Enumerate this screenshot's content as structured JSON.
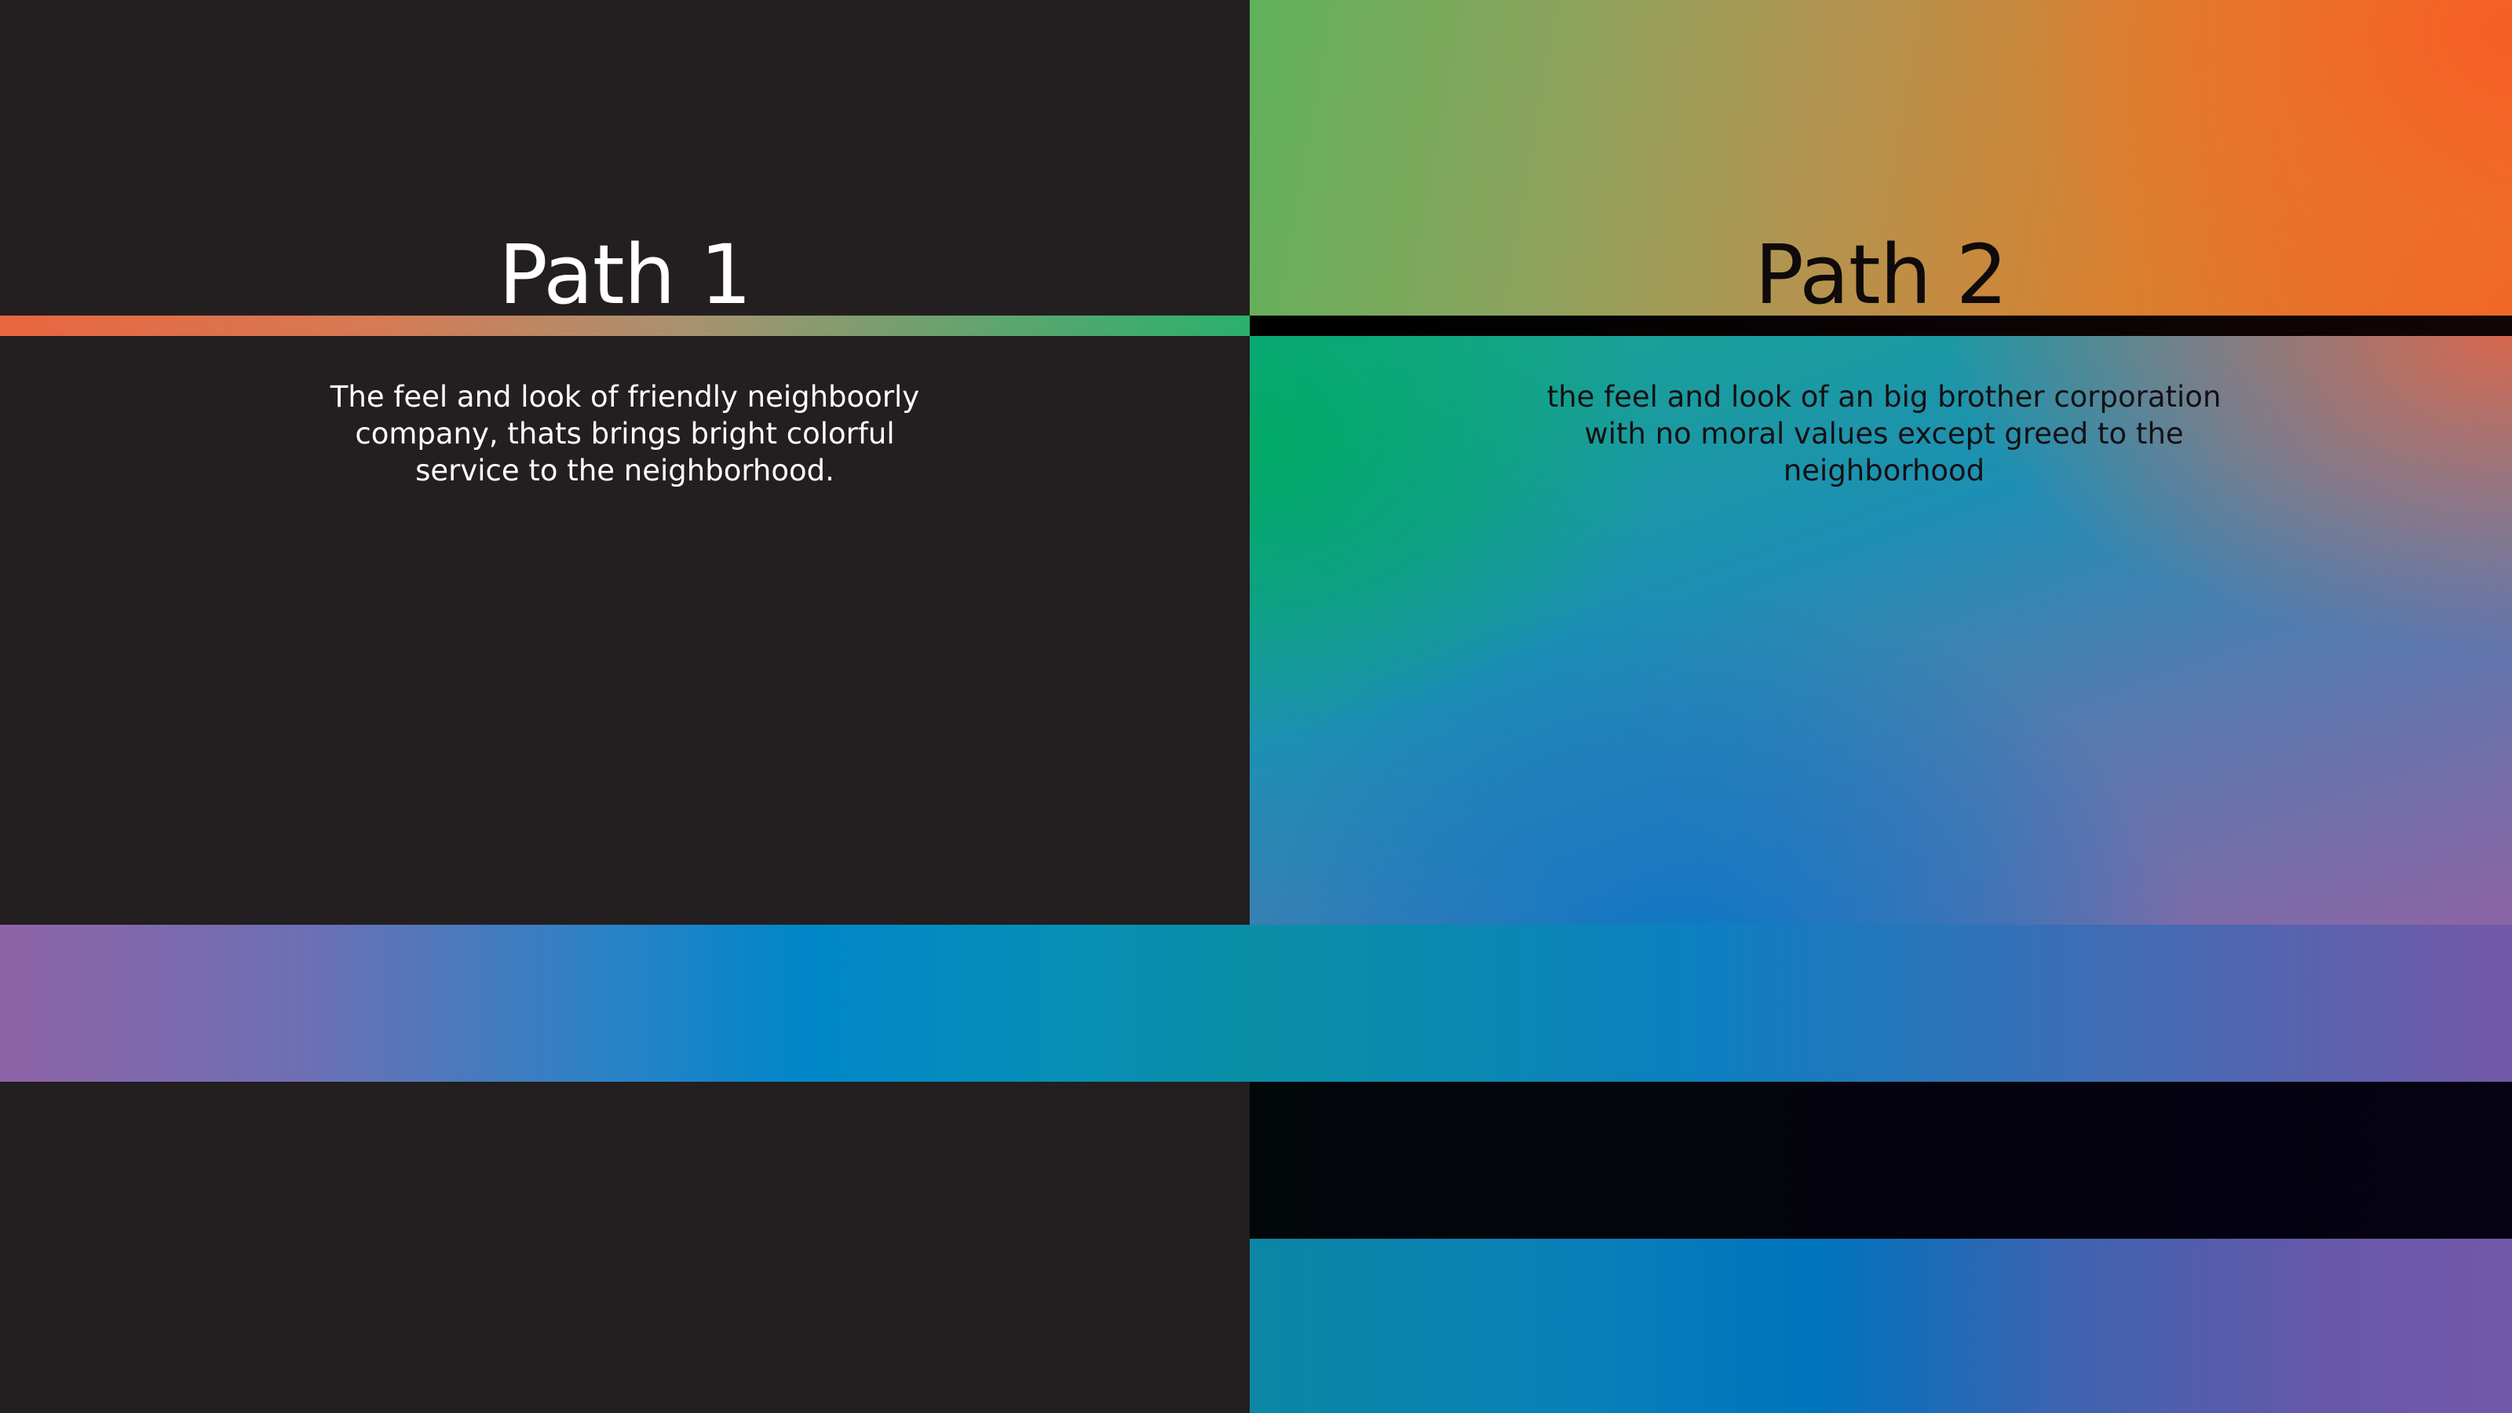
{
  "path1": {
    "title": "Path 1",
    "description": "The feel and look of friendly neighboorly company, thats brings bright colorful service to the neighborhood."
  },
  "path2": {
    "title": "Path 2",
    "description": "the feel and look of an big brother corporation with no moral values except greed to the neighborhood"
  },
  "colors": {
    "dark_background": "#231f20",
    "orange": "#f26425",
    "green": "#00a865",
    "blue": "#0078c0",
    "purple": "#7358a8",
    "black": "#000000"
  }
}
